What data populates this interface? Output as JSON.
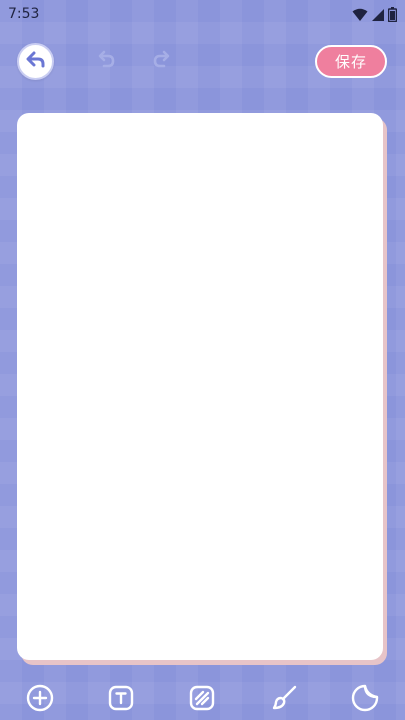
{
  "status_bar": {
    "time": "7:53",
    "icons": [
      "wifi-icon",
      "signal-icon",
      "battery-icon"
    ]
  },
  "toolbar": {
    "back_icon": "back-arrow-icon",
    "undo_icon": "undo-icon",
    "redo_icon": "redo-icon",
    "save_label": "保存"
  },
  "bottom_tools": [
    {
      "icon": "add-circle-icon"
    },
    {
      "icon": "text-icon"
    },
    {
      "icon": "pattern-icon"
    },
    {
      "icon": "brush-icon"
    },
    {
      "icon": "sticker-icon"
    }
  ],
  "colors": {
    "background": "#8b95db",
    "save_button": "#ef7f9e",
    "canvas": "#ffffff",
    "canvas_shadow": "#e7c4c8",
    "icon_active": "#ffffff",
    "icon_disabled": "#a6aee6"
  }
}
